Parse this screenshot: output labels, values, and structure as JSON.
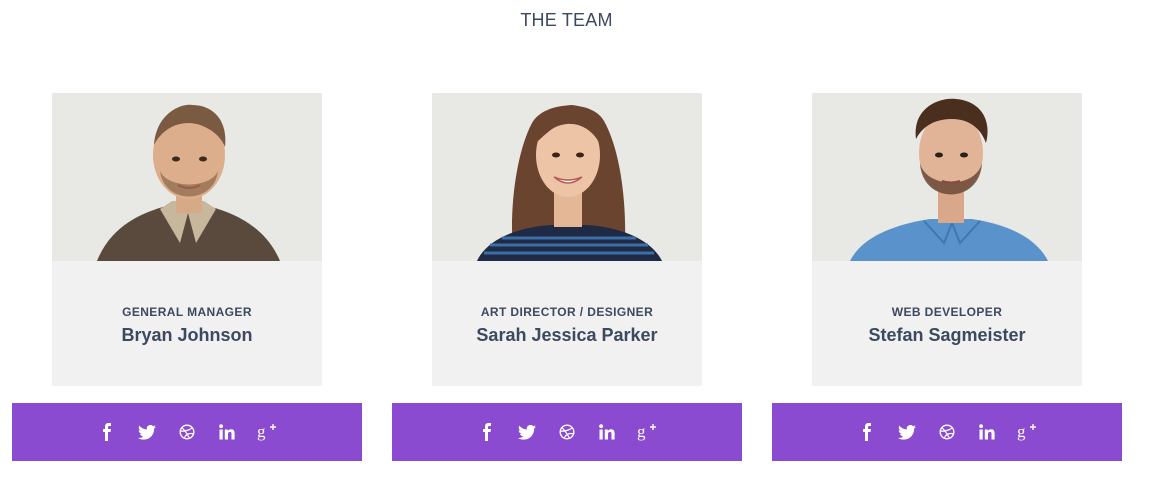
{
  "section": {
    "title": "THE TEAM"
  },
  "members": [
    {
      "role": "GENERAL MANAGER",
      "name": "Bryan Johnson",
      "photo": "man-brown-jacket-photo"
    },
    {
      "role": "ART DIRECTOR / DESIGNER",
      "name": "Sarah Jessica Parker",
      "photo": "woman-long-hair-photo"
    },
    {
      "role": "WEB DEVELOPER",
      "name": "Stefan Sagmeister",
      "photo": "man-blue-shirt-photo"
    }
  ],
  "social_icons": [
    "facebook-icon",
    "twitter-icon",
    "dribbble-icon",
    "linkedin-icon",
    "google-plus-icon"
  ],
  "colors": {
    "accent": "#8a4bd0",
    "card": "#f1f1f1",
    "text": "#3b4a5e",
    "photo_bg": "#e8e8e4"
  }
}
